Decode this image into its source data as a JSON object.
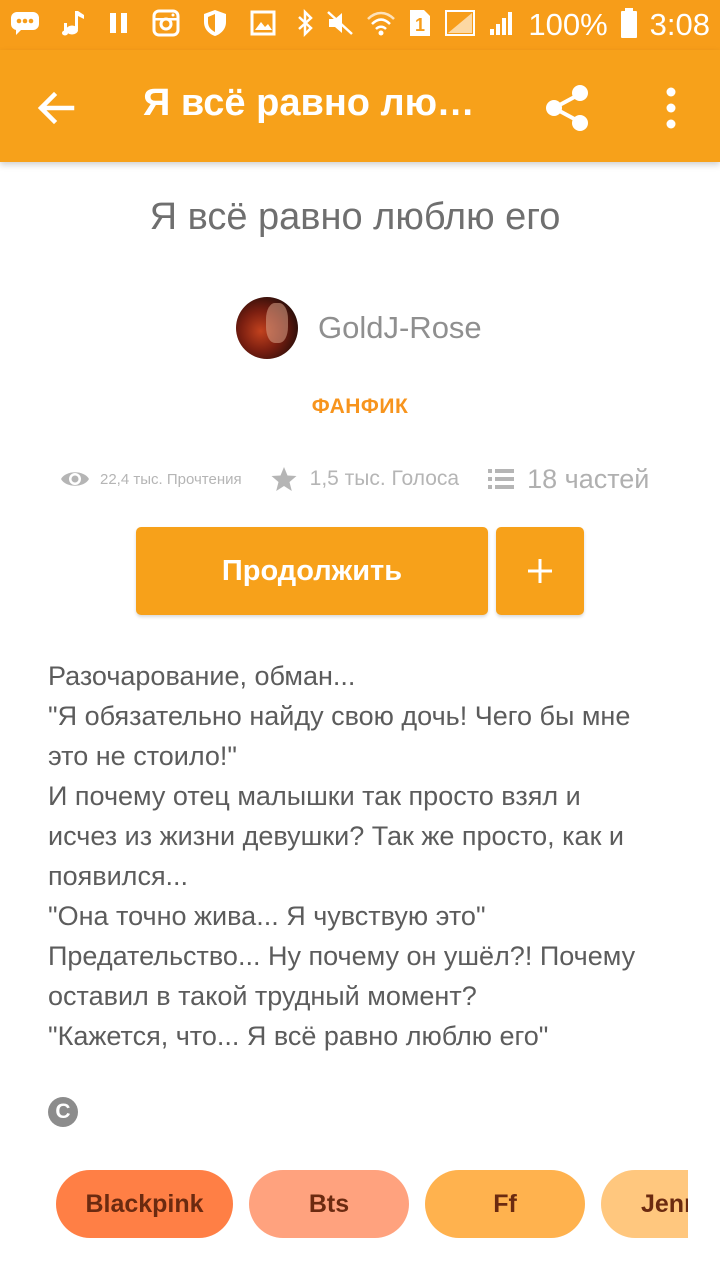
{
  "status_bar": {
    "battery": "100%",
    "time": "3:08",
    "sim_badge": "1"
  },
  "app_bar": {
    "title": "Я всё равно любл..."
  },
  "story": {
    "title": "Я всё равно люблю его",
    "author": "GoldJ-Rose",
    "category": "ФАНФИК",
    "reads": "22,4 тыс. Прочтения",
    "votes": "1,5 тыс. Голоса",
    "parts": "18 частей"
  },
  "actions": {
    "continue_label": "Продолжить",
    "add_label": "+"
  },
  "description": [
    "Разочарование, обман...",
    "\"Я обязательно найду свою дочь! Чего бы мне",
    "это не стоило!\"",
    "И почему отец малышки так просто взял и",
    "исчез из жизни девушки? Так же просто, как и",
    "появился...",
    "\"Она точно жива... Я чувствую это\"",
    "Предательство... Ну почему он ушёл?! Почему",
    "оставил в такой трудный момент?",
    "\"Кажется, что... Я всё равно люблю его\""
  ],
  "copyright_symbol": "C",
  "tags": [
    {
      "label": "Blackpink",
      "color": "#ff7f45"
    },
    {
      "label": "Bts",
      "color": "#ffa27e"
    },
    {
      "label": "Ff",
      "color": "#ffb24e"
    },
    {
      "label": "Jenn",
      "color": "#ffc77e"
    }
  ],
  "colors": {
    "accent": "#f7a11a",
    "category": "#f7941d"
  }
}
